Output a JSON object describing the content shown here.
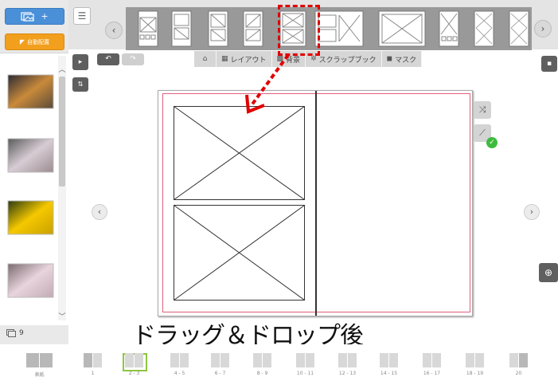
{
  "sidebar": {
    "add_photo_label": "+",
    "auto_label": "自動配置",
    "photo_count": "9",
    "photos": [
      {
        "name": "sunset",
        "colors": [
          "#2a2a35",
          "#c98a3a",
          "#5a4a3a"
        ]
      },
      {
        "name": "blossom-1",
        "colors": [
          "#5a5a5a",
          "#d8ccd4",
          "#9a8c90"
        ]
      },
      {
        "name": "yellow-flowers",
        "colors": [
          "#2a3a10",
          "#f5c800",
          "#c8a000"
        ]
      },
      {
        "name": "blossom-2",
        "colors": [
          "#7a6a70",
          "#e8d4dc",
          "#c2aab5"
        ]
      }
    ]
  },
  "toolbar": {
    "tabs": [
      {
        "id": "home",
        "icon": "home-icon",
        "label": ""
      },
      {
        "id": "layout",
        "icon": "grid-icon",
        "label": "レイアウト"
      },
      {
        "id": "background",
        "icon": "checker-icon",
        "label": "背景"
      },
      {
        "id": "scrapbook",
        "icon": "sparkle-icon",
        "label": "スクラップブック"
      },
      {
        "id": "mask",
        "icon": "square-icon",
        "label": "マスク"
      }
    ],
    "undo_glyph": "↶",
    "redo_glyph": "↷"
  },
  "caption": "ドラッグ＆ドロップ後",
  "pages": [
    {
      "label": "表紙",
      "cover": true
    },
    {
      "label": "1"
    },
    {
      "label": "2 - 3",
      "selected": true
    },
    {
      "label": "4 - 5"
    },
    {
      "label": "6 - 7"
    },
    {
      "label": "8 - 9"
    },
    {
      "label": "10 - 11"
    },
    {
      "label": "12 - 13"
    },
    {
      "label": "14 - 15"
    },
    {
      "label": "16 - 17"
    },
    {
      "label": "18 - 19"
    },
    {
      "label": "20"
    }
  ],
  "colors": {
    "accent_blue": "#4a90d9",
    "accent_orange": "#f29f1e",
    "highlight_red": "#e00000",
    "selected_green": "#8ec63f",
    "ok_green": "#3dbb3d"
  }
}
